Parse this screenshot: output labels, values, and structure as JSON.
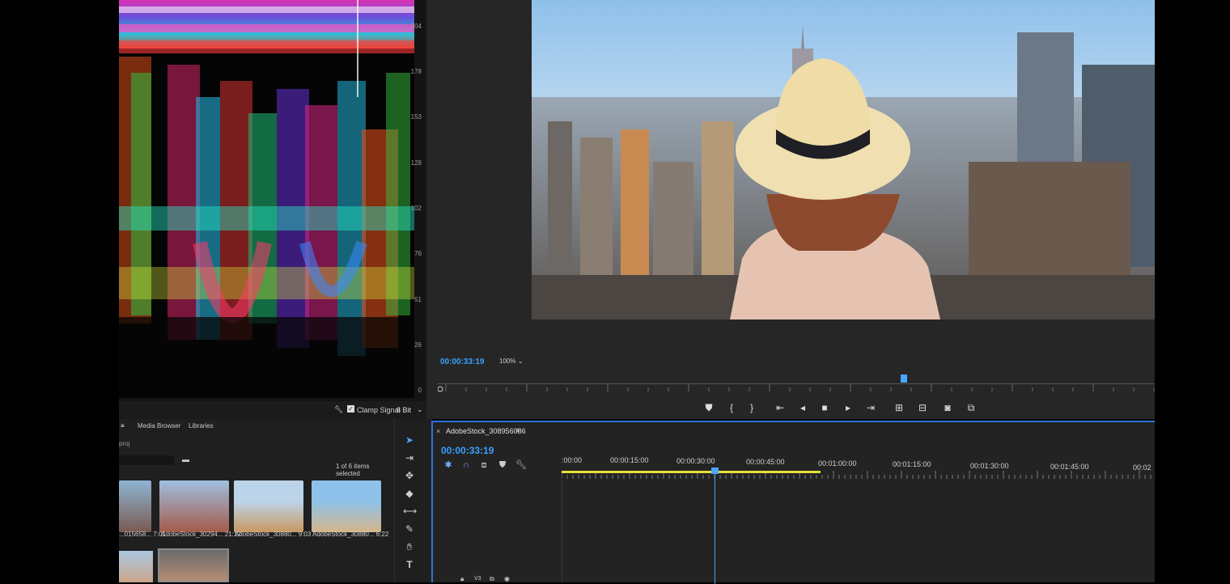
{
  "scopes": {
    "tick_labels": [
      "204",
      "178",
      "153",
      "128",
      "102",
      "76",
      "51",
      "26",
      "0"
    ],
    "clamp_label": "Clamp Signal",
    "bit_depth": "8 Bit"
  },
  "program": {
    "timecode": "00:00:33:19",
    "zoom": "100%",
    "playhead_fraction": 0.65
  },
  "project": {
    "tabs": [
      "Media Browser",
      "Libraries"
    ],
    "path": "proj",
    "selection_status": "1 of 6 items selected",
    "items": [
      {
        "name": "...015658...",
        "duration": "7:01"
      },
      {
        "name": "AdobeStock_30294...",
        "duration": "21:12"
      },
      {
        "name": "AdobeStock_30880...",
        "duration": "9:03"
      },
      {
        "name": "AdobeStock_30880...",
        "duration": "6:22"
      }
    ]
  },
  "timeline": {
    "sequence_name": "AdobeStock_308956086",
    "timecode": "00:00:33:19",
    "ruler": [
      ":00:00",
      "00:00:15:00",
      "00:00:30:00",
      "00:00:45:00",
      "00:01:00:00",
      "00:01:15:00",
      "00:01:30:00",
      "00:01:45:00",
      "00:02"
    ],
    "track_label": "V3"
  },
  "colors": {
    "accent": "#3aa0ff",
    "panel_border": "#2d74d8",
    "work_area": "#e6e03a"
  }
}
